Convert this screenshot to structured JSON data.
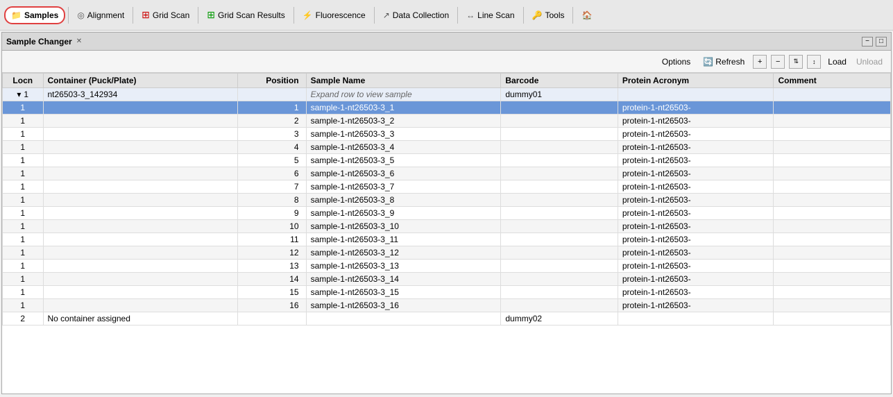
{
  "menubar": {
    "items": [
      {
        "id": "samples",
        "label": "Samples",
        "icon": "📁",
        "active": true
      },
      {
        "id": "alignment",
        "label": "Alignment",
        "icon": "◎",
        "active": false
      },
      {
        "id": "gridscan",
        "label": "Grid Scan",
        "icon": "⊞",
        "active": false
      },
      {
        "id": "gridscanresults",
        "label": "Grid Scan Results",
        "icon": "⊞",
        "active": false
      },
      {
        "id": "fluorescence",
        "label": "Fluorescence",
        "icon": "⚡",
        "active": false
      },
      {
        "id": "datacollection",
        "label": "Data Collection",
        "icon": "↗",
        "active": false
      },
      {
        "id": "linescan",
        "label": "Line Scan",
        "icon": "↔",
        "active": false
      },
      {
        "id": "tools",
        "label": "Tools",
        "icon": "🔑",
        "active": false
      },
      {
        "id": "home",
        "label": "",
        "icon": "🏠",
        "active": false
      }
    ]
  },
  "panel": {
    "title": "Sample Changer",
    "close_label": "✕"
  },
  "toolbar": {
    "options_label": "Options",
    "refresh_label": "Refresh",
    "load_label": "Load",
    "unload_label": "Unload",
    "refresh_icon": "🔄"
  },
  "table": {
    "columns": [
      "Locn",
      "Container (Puck/Plate)",
      "Position",
      "Sample Name",
      "Barcode",
      "Protein Acronym",
      "Comment"
    ],
    "container_row": {
      "locn": "1",
      "container": "nt26503-3_142934",
      "position": "",
      "sample_name": "Expand row to view sample",
      "barcode": "dummy01",
      "protein": "",
      "comment": ""
    },
    "samples": [
      {
        "locn": "1",
        "position": "1",
        "sample_name": "sample-1-nt26503-3_1",
        "barcode": "",
        "protein": "protein-1-nt26503-",
        "comment": "",
        "selected": true
      },
      {
        "locn": "1",
        "position": "2",
        "sample_name": "sample-1-nt26503-3_2",
        "barcode": "",
        "protein": "protein-1-nt26503-",
        "comment": ""
      },
      {
        "locn": "1",
        "position": "3",
        "sample_name": "sample-1-nt26503-3_3",
        "barcode": "",
        "protein": "protein-1-nt26503-",
        "comment": ""
      },
      {
        "locn": "1",
        "position": "4",
        "sample_name": "sample-1-nt26503-3_4",
        "barcode": "",
        "protein": "protein-1-nt26503-",
        "comment": ""
      },
      {
        "locn": "1",
        "position": "5",
        "sample_name": "sample-1-nt26503-3_5",
        "barcode": "",
        "protein": "protein-1-nt26503-",
        "comment": ""
      },
      {
        "locn": "1",
        "position": "6",
        "sample_name": "sample-1-nt26503-3_6",
        "barcode": "",
        "protein": "protein-1-nt26503-",
        "comment": ""
      },
      {
        "locn": "1",
        "position": "7",
        "sample_name": "sample-1-nt26503-3_7",
        "barcode": "",
        "protein": "protein-1-nt26503-",
        "comment": ""
      },
      {
        "locn": "1",
        "position": "8",
        "sample_name": "sample-1-nt26503-3_8",
        "barcode": "",
        "protein": "protein-1-nt26503-",
        "comment": ""
      },
      {
        "locn": "1",
        "position": "9",
        "sample_name": "sample-1-nt26503-3_9",
        "barcode": "",
        "protein": "protein-1-nt26503-",
        "comment": ""
      },
      {
        "locn": "1",
        "position": "10",
        "sample_name": "sample-1-nt26503-3_10",
        "barcode": "",
        "protein": "protein-1-nt26503-",
        "comment": ""
      },
      {
        "locn": "1",
        "position": "11",
        "sample_name": "sample-1-nt26503-3_11",
        "barcode": "",
        "protein": "protein-1-nt26503-",
        "comment": ""
      },
      {
        "locn": "1",
        "position": "12",
        "sample_name": "sample-1-nt26503-3_12",
        "barcode": "",
        "protein": "protein-1-nt26503-",
        "comment": ""
      },
      {
        "locn": "1",
        "position": "13",
        "sample_name": "sample-1-nt26503-3_13",
        "barcode": "",
        "protein": "protein-1-nt26503-",
        "comment": ""
      },
      {
        "locn": "1",
        "position": "14",
        "sample_name": "sample-1-nt26503-3_14",
        "barcode": "",
        "protein": "protein-1-nt26503-",
        "comment": ""
      },
      {
        "locn": "1",
        "position": "15",
        "sample_name": "sample-1-nt26503-3_15",
        "barcode": "",
        "protein": "protein-1-nt26503-",
        "comment": ""
      },
      {
        "locn": "1",
        "position": "16",
        "sample_name": "sample-1-nt26503-3_16",
        "barcode": "",
        "protein": "protein-1-nt26503-",
        "comment": ""
      }
    ],
    "footer_row": {
      "locn": "2",
      "container": "No container assigned",
      "barcode": "dummy02"
    }
  }
}
